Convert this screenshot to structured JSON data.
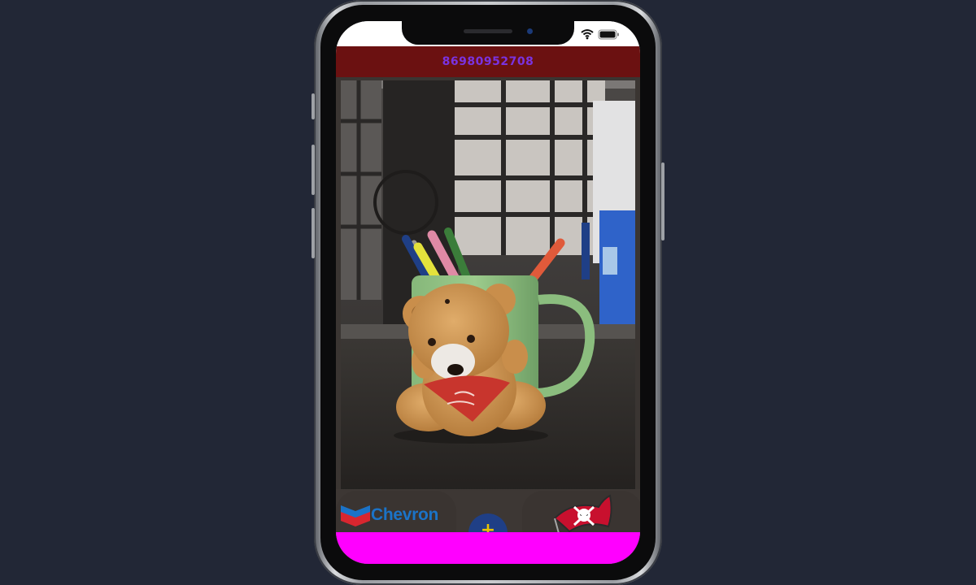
{
  "colors": {
    "page_background": "#222736",
    "header_background": "#6b1111",
    "title_color": "#7a33e0",
    "chevron_text": "#1b73c7",
    "fab_background": "#1f3f86",
    "fab_plus": "#e9c400",
    "bottom_bar": "#ff00ff"
  },
  "header": {
    "title": "86980952708"
  },
  "status_bar": {
    "icons": [
      "wifi-icon",
      "battery-icon"
    ]
  },
  "video": {
    "subject": "teddy-bear-with-mug"
  },
  "cards": {
    "left_logo_text": "Chevron",
    "right_logo_icon": "buccaneers-flag-icon"
  },
  "fab": {
    "label": "+"
  }
}
